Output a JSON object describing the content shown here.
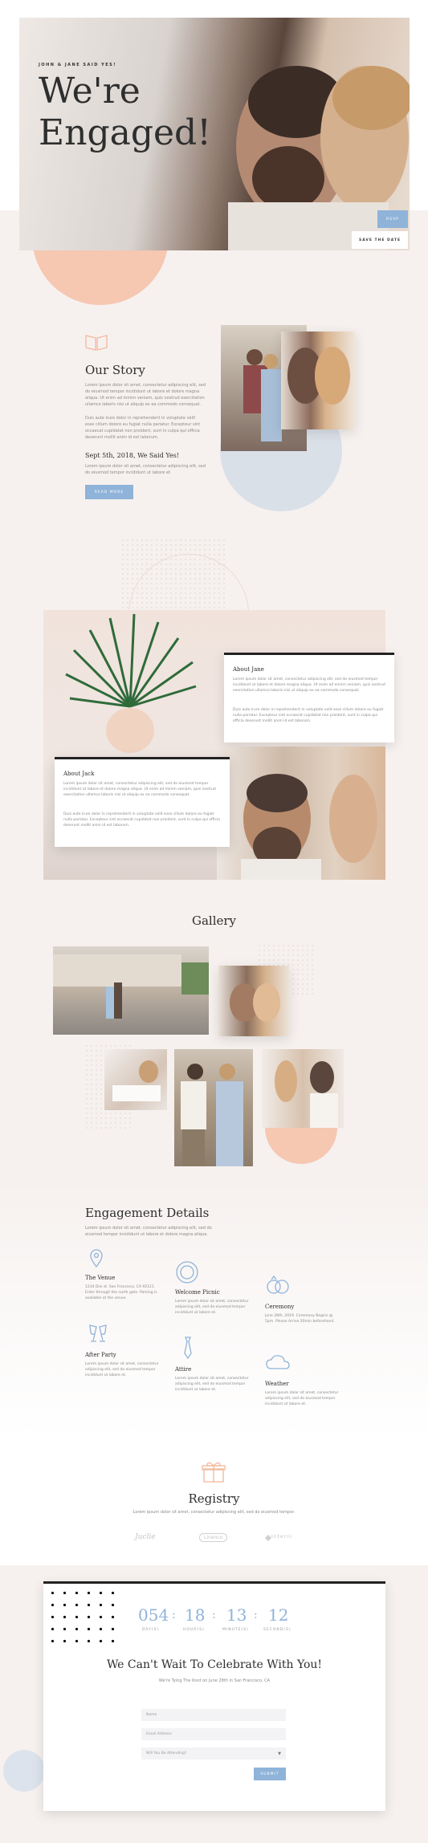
{
  "hero": {
    "names": "JOHN & JANE SAID YES!",
    "title_line1": "We're",
    "title_line2": "Engaged!",
    "rsvp_button": "RSVP",
    "save_button": "SAVE THE DATE"
  },
  "story": {
    "title": "Our Story",
    "paragraph1": "Lorem ipsum dolor sit amet, consectetur adipiscing elit, sed do eiusmod tempor incididunt ut labore et dolore magna aliqua. Ut enim ad minim veniam, quis nostrud exercitation ullamco laboris nisi ut aliquip ex ea commodo consequat.",
    "paragraph2": "Duis aute irure dolor in reprehenderit in voluptate velit esse cillum dolore eu fugiat nulla pariatur. Excepteur sint occaecat cupidatat non proident, sunt in culpa qui officia deserunt mollit anim id est laborum.",
    "date_heading": "Sept 5th, 2018, We Said Yes!",
    "paragraph3": "Lorem ipsum dolor sit amet, consectetur adipiscing elit, sed do eiusmod tempor incididunt ut labore et.",
    "read_more": "READ MORE"
  },
  "about_jane": {
    "title": "About Jane",
    "p1": "Lorem ipsum dolor sit amet, consectetur adipiscing elit, sed do eiusmod tempor incididunt ut labore et dolore magna aliqua. Ut enim ad minim veniam, quis nostrud exercitation ullamco laboris nisi ut aliquip ex ea commodo consequat.",
    "p2": "Duis aute irure dolor in reprehenderit in voluptate velit esse cillum dolore eu fugiat nulla pariatur. Excepteur sint occaecat cupidatat non proident, sunt in culpa qui officia deserunt mollit anim id est laborum."
  },
  "about_jack": {
    "title": "About Jack",
    "p1": "Lorem ipsum dolor sit amet, consectetur adipiscing elit, sed do eiusmod tempor incididunt ut labore et dolore magna aliqua. Ut enim ad minim veniam, quis nostrud exercitation ullamco laboris nisi ut aliquip ex ea commodo consequat.",
    "p2": "Duis aute irure dolor in reprehenderit in voluptate velit esse cillum dolore eu fugiat nulla pariatur. Excepteur sint occaecat cupidatat non proident, sunt in culpa qui officia deserunt mollit anim id est laborum."
  },
  "gallery": {
    "title": "Gallery"
  },
  "details": {
    "title": "Engagement Details",
    "intro": "Lorem ipsum dolor sit amet, consectetur adipiscing elit, sed do eiusmod tempor incididunt ut labore et dolore magna aliqua.",
    "items": [
      {
        "title": "The Venue",
        "text": "1234 Divi st. San Francisco, CA 92121. Enter through the north gate. Parking is available at the venue."
      },
      {
        "title": "Welcome Picnic",
        "text": "Lorem ipsum dolor sit amet, consectetur adipiscing elit, sed do eiusmod tempor incididunt ut labore et."
      },
      {
        "title": "Ceremony",
        "text": "June 28th, 2019. Ceremony Begins @ 5pm. Please Arrive 20min beforehand."
      },
      {
        "title": "After Party",
        "text": "Lorem ipsum dolor sit amet, consectetur adipiscing elit, sed do eiusmod tempor incididunt ut labore et."
      },
      {
        "title": "Attire",
        "text": "Lorem ipsum dolor sit amet, consectetur adipiscing elit, sed do eiusmod tempor incididunt ut labore et."
      },
      {
        "title": "Weather",
        "text": "Lorem ipsum dolor sit amet, consectetur adipiscing elit, sed do eiusmod tempor incididunt ut labore et."
      }
    ]
  },
  "registry": {
    "title": "Registry",
    "text": "Lorem ipsum dolor sit amet, consectetur adipiscing elit, sed do eiusmod tempor.",
    "logos": [
      "Juclie",
      "Linenco",
      "Interni"
    ]
  },
  "countdown": {
    "units": [
      {
        "value": "054",
        "label": "DAY(S)"
      },
      {
        "value": "18",
        "label": "HOUR(S)"
      },
      {
        "value": "13",
        "label": "MINUTE(S)"
      },
      {
        "value": "12",
        "label": "SECOND(S)"
      }
    ],
    "heading": "We Can't Wait To Celebrate With You!",
    "subheading": "We're Tying The Knot on June 28th in San Francisco, CA",
    "name_placeholder": "Name",
    "email_placeholder": "Email Address",
    "select_value": "Will You Be Attending?",
    "submit": "SUBMIT"
  },
  "colors": {
    "accent_blue": "#8fb3d9",
    "peach": "#f6c7b1",
    "background": "#f6f1ef"
  }
}
